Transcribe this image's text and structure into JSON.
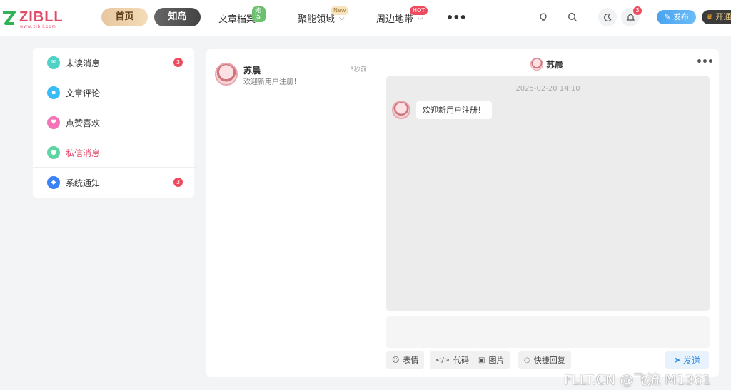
{
  "header": {
    "logo_text": "ZIBLL",
    "logo_tagline": "www.zibll.com",
    "nav_home": "首页",
    "nav_zhidao": "知岛",
    "nav_items": [
      {
        "label": "文章档案",
        "badge": "纯净",
        "badge_color": "#6cc070"
      },
      {
        "label": "聚能领域",
        "badge": "New",
        "badge_color": "#f3dca8"
      },
      {
        "label": "周边地带",
        "badge": "HOT",
        "badge_color": "#ef4b5f"
      }
    ],
    "notification_count": "3",
    "publish_label": "发布",
    "vip_label": "开通"
  },
  "sidebar": {
    "items": [
      {
        "label": "未读消息",
        "icon": "mail-icon",
        "color": "#4fd1c5",
        "badge": "3"
      },
      {
        "label": "文章评论",
        "icon": "comment-icon",
        "color": "#38bdf8",
        "badge": ""
      },
      {
        "label": "点赞喜欢",
        "icon": "heart-icon",
        "color": "#f472b6",
        "badge": ""
      },
      {
        "label": "私信消息",
        "icon": "message-icon",
        "color": "#5ed6a3",
        "badge": ""
      },
      {
        "label": "系统通知",
        "icon": "bell-drop-icon",
        "color": "#3b82f6",
        "badge": "3"
      }
    ]
  },
  "conversation": {
    "name": "苏晨",
    "preview": "欢迎新用户注册！",
    "time": "3秒前"
  },
  "chat": {
    "title": "苏晨",
    "timestamp": "2025-02-20 14:10",
    "message": "欢迎新用户注册！",
    "tools": [
      "表情",
      "代码",
      "图片",
      "快捷回复"
    ],
    "send_label": "发送"
  },
  "watermark": "FLLT.CN @飞流 M1361"
}
